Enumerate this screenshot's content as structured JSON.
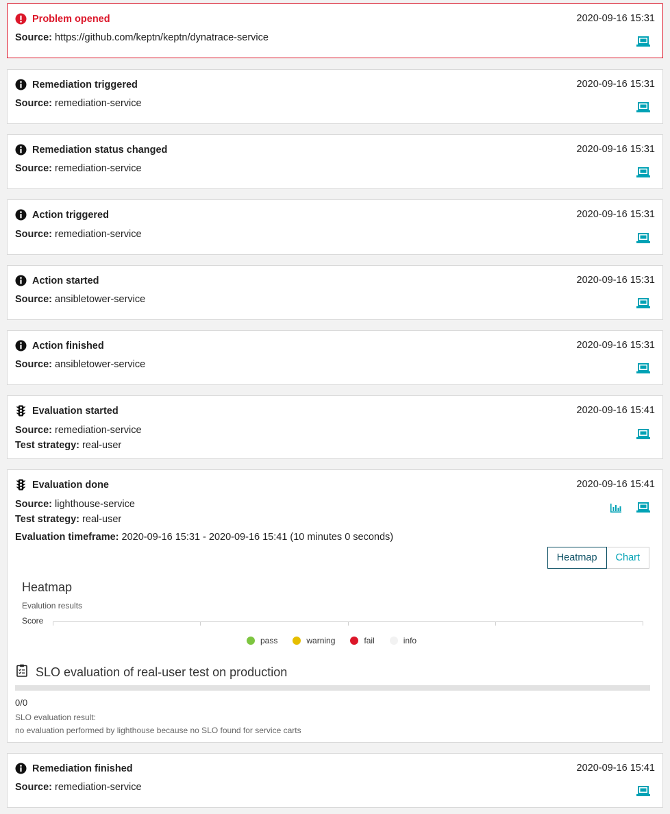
{
  "labels": {
    "source": "Source:",
    "test_strategy": "Test strategy:",
    "evaluation_timeframe": "Evaluation timeframe:"
  },
  "colors": {
    "problem_red": "#dc172a",
    "icon_teal": "#00a2b5",
    "pass": "#7dc540",
    "warning": "#e6be00",
    "fail": "#dc172a",
    "info": "#f2f2f2"
  },
  "events": [
    {
      "title": "Problem opened",
      "icon": "alert-circle-icon",
      "timestamp": "2020-09-16 15:31",
      "source": "https://github.com/keptn/keptn/dynatrace-service"
    },
    {
      "title": "Remediation triggered",
      "icon": "info-icon",
      "timestamp": "2020-09-16 15:31",
      "source": "remediation-service"
    },
    {
      "title": "Remediation status changed",
      "icon": "info-icon",
      "timestamp": "2020-09-16 15:31",
      "source": "remediation-service"
    },
    {
      "title": "Action triggered",
      "icon": "info-icon",
      "timestamp": "2020-09-16 15:31",
      "source": "remediation-service"
    },
    {
      "title": "Action started",
      "icon": "info-icon",
      "timestamp": "2020-09-16 15:31",
      "source": "ansibletower-service"
    },
    {
      "title": "Action finished",
      "icon": "info-icon",
      "timestamp": "2020-09-16 15:31",
      "source": "ansibletower-service"
    },
    {
      "title": "Evaluation started",
      "icon": "traffic-light-icon",
      "timestamp": "2020-09-16 15:41",
      "source": "remediation-service",
      "test_strategy": "real-user"
    },
    {
      "title": "Evaluation done",
      "icon": "traffic-light-icon",
      "timestamp": "2020-09-16 15:41",
      "source": "lighthouse-service",
      "test_strategy": "real-user",
      "evaluation_timeframe": "2020-09-16 15:31 - 2020-09-16 15:41 (10 minutes 0 seconds)"
    },
    {
      "title": "Remediation finished",
      "icon": "info-icon",
      "timestamp": "2020-09-16 15:41",
      "source": "remediation-service"
    }
  ],
  "evaluation": {
    "toggle": {
      "heatmap": "Heatmap",
      "chart": "Chart",
      "selected": "Heatmap"
    },
    "heatmap": {
      "title": "Heatmap",
      "subtitle": "Evalution results",
      "y_label": "Score",
      "legend": [
        {
          "label": "pass",
          "color": "#7dc540"
        },
        {
          "label": "warning",
          "color": "#e6be00"
        },
        {
          "label": "fail",
          "color": "#dc172a"
        },
        {
          "label": "info",
          "color": "#f2f2f2"
        }
      ]
    },
    "slo": {
      "title": "SLO evaluation of real-user test on production",
      "score": "0/0",
      "result_label": "SLO evaluation result:",
      "result_text": "no evaluation performed by lighthouse because no SLO found for service carts"
    }
  }
}
